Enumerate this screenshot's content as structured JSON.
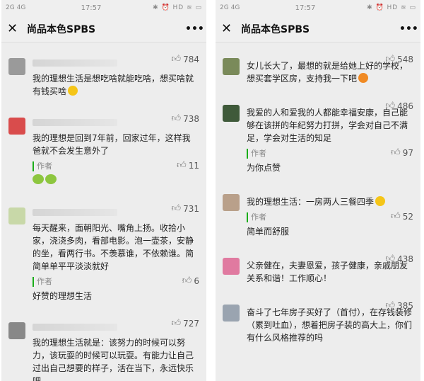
{
  "left_panel": {
    "status": {
      "signal": "2G",
      "signal2": "4G",
      "time": "17:57",
      "indicators": "✱ ⏰ HD ≋ ▭"
    },
    "title": "尚品本色SPBS",
    "comments": [
      {
        "likes": "784",
        "text": "我的理想生活是想吃啥就能吃啥，想买啥就有钱买啥",
        "emoji": "smile",
        "avatar_color": "#9a9a9a"
      },
      {
        "likes": "738",
        "text": "我的理想是回到7年前，回家过年，这样我爸就不会发生意外了",
        "avatar_color": "#d94c4c",
        "author": {
          "label": "作者",
          "likes": "11",
          "reply": "🐸🐸"
        }
      },
      {
        "likes": "731",
        "text": "每天醒来，面朝阳光、嘴角上扬。收拾小家，浇浇多肉，看部电影。泡一壶茶，安静的坐，看两行书。不羡慕谁，不依赖谁。简简单单平平淡淡就好",
        "avatar_color": "#c8d8a8",
        "author": {
          "label": "作者",
          "likes": "6",
          "reply": "好赞的理想生活"
        }
      },
      {
        "likes": "727",
        "text": "我的理想生活就是：该努力的时候可以努力，该玩耍的时候可以玩耍。有能力让自己过出自己想要的样子，活在当下，永远快乐吧。",
        "avatar_color": "#888888"
      }
    ]
  },
  "right_panel": {
    "status": {
      "signal": "2G",
      "signal2": "4G",
      "time": "17:57",
      "indicators": "✱ ⏰ HD ≋ ▭"
    },
    "title": "尚品本色SPBS",
    "comments": [
      {
        "likes": "548",
        "text": "女儿长大了，最想的就是给她上好的学校，想买套学区房，支持我一下吧",
        "emoji": "red",
        "avatar_color": "#7a8a5a"
      },
      {
        "likes": "486",
        "text": "我爱的人和爱我的人都能幸福安康，自己能够在该拼的年纪努力打拼，学会对自己不满足，学会对生活的知足",
        "avatar_color": "#3f5a3a",
        "author": {
          "label": "作者",
          "likes": "97",
          "reply": "为你点赞"
        }
      },
      {
        "likes": "",
        "text": "我的理想生活：一房两人三餐四季",
        "emoji": "grin",
        "avatar_color": "#b9a08a",
        "author": {
          "label": "作者",
          "likes": "52",
          "reply": "简单而舒服"
        }
      },
      {
        "likes": "438",
        "text": "父亲健在，夫妻恩爱，孩子健康，亲戚朋友关系和谐！工作顺心！",
        "avatar_color": "#e07aa0"
      },
      {
        "likes": "385",
        "text": "奋斗了七年房子买好了（首付），在存钱装修（累到吐血），想着把房子装的高大上，你们有什么风格推荐的吗",
        "avatar_color": "#9aa4b0"
      }
    ]
  }
}
